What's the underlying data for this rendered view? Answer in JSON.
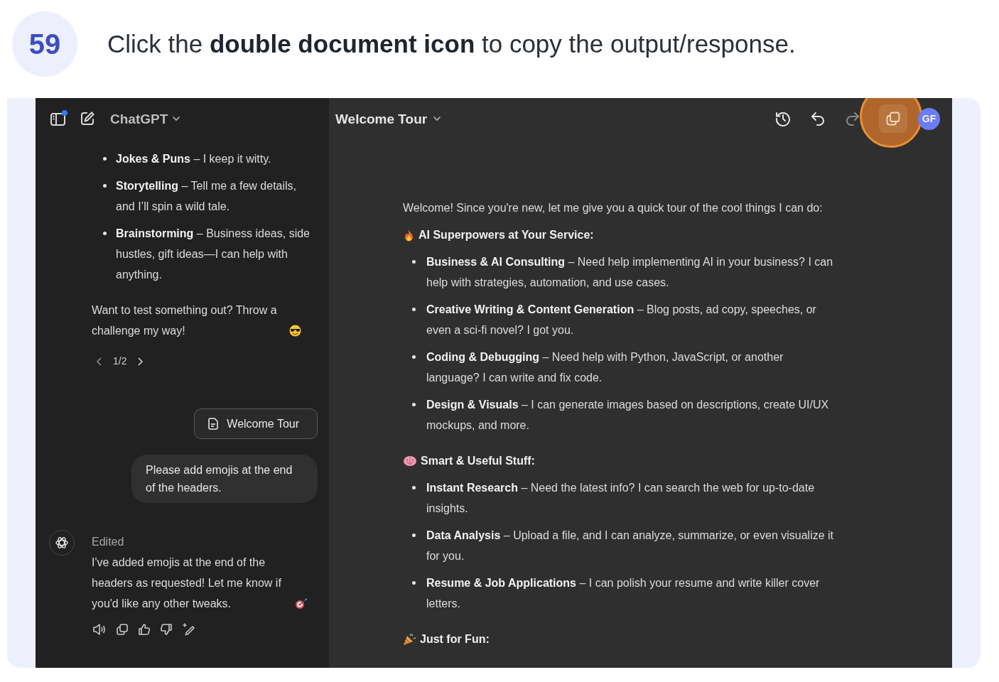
{
  "step": {
    "number": "59",
    "instruction": "Click the **double document icon** to copy the output/response."
  },
  "sidebar": {
    "title": "ChatGPT",
    "items": [
      {
        "text": "**Jokes & Puns** – I keep it witty."
      },
      {
        "text": "**Storytelling** – Tell me a few details, and I’ll spin a wild tale."
      },
      {
        "text": "**Brainstorming** – Business ideas, side hustles, gift ideas—I can help with anything."
      }
    ],
    "closing": "Want to test something out? Throw a challenge my way!",
    "pager": "1/2",
    "document_chip": "Welcome Tour",
    "user_message": "Please add emojis at the end of the headers.",
    "reply_status": "Edited",
    "reply": "I've added emojis at the end of the headers as requested! Let me know if you'd like any other tweaks."
  },
  "canvas": {
    "title": "Welcome Tour",
    "toolbar": [
      {
        "kind": "history",
        "highlighted": false
      },
      {
        "kind": "undo",
        "highlighted": false
      },
      {
        "kind": "redo",
        "highlighted": false
      },
      {
        "kind": "copy",
        "highlighted": true
      }
    ],
    "avatar": "GF",
    "intro": "Welcome! Since you're new, let me give you a quick tour of the cool things I can do:",
    "sections": [
      {
        "kind": "fire",
        "heading": "AI Superpowers at Your Service:",
        "items": [
          "**Business & AI Consulting** – Need help implementing AI in your business? I can help with strategies, automation, and use cases.",
          "**Creative Writing & Content Generation** – Blog posts, ad copy, speeches, or even a sci-fi novel? I got you.",
          "**Coding & Debugging** – Need help with Python, JavaScript, or another language? I can write and fix code.",
          "**Design & Visuals** – I can generate images based on descriptions, create UI/UX mockups, and more."
        ]
      },
      {
        "kind": "brain",
        "heading": "Smart & Useful Stuff:",
        "items": [
          "**Instant Research** – Need the latest info? I can search the web for up-to-date insights.",
          "**Data Analysis** – Upload a file, and I can analyze, summarize, or even visualize it for you.",
          "**Resume & Job Applications** – I can polish your resume and write killer cover letters."
        ]
      },
      {
        "kind": "party",
        "heading": "Just for Fun:"
      }
    ]
  }
}
